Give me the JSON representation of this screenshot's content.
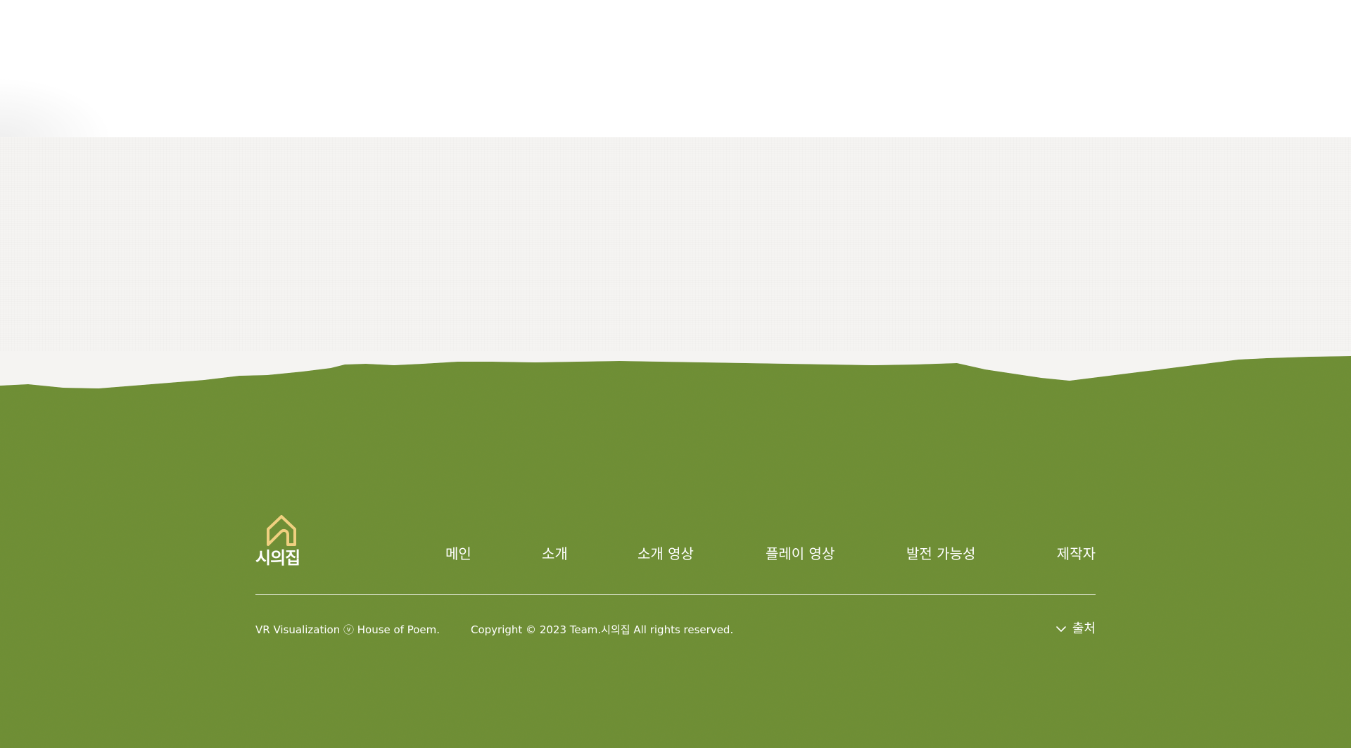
{
  "colors": {
    "green_background": "#6e8f35",
    "paper": "#f5f4f2",
    "logo_gold": "#f0d080",
    "text": "#ffffff"
  },
  "logo": {
    "icon": "house-icon",
    "text": "시의집"
  },
  "nav": {
    "items": [
      {
        "label": "메인"
      },
      {
        "label": "소개"
      },
      {
        "label": "소개 영상"
      },
      {
        "label": "플레이 영상"
      },
      {
        "label": "발전 가능성"
      },
      {
        "label": "제작자"
      }
    ]
  },
  "footer": {
    "tagline": "VR Visualization ⓥ House of  Poem.",
    "copyright": "Copyright © 2023 Team.시의집 All rights reserved.",
    "source_toggle": {
      "icon": "chevron-down-icon",
      "label": "출처"
    }
  }
}
